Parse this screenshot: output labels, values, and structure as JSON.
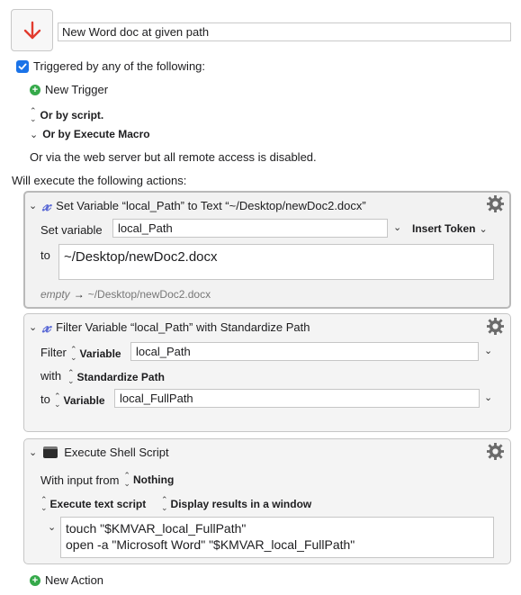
{
  "macro": {
    "name": "New Word doc at given path"
  },
  "triggers": {
    "triggered_label": "Triggered by any of the following:",
    "new_trigger": "New Trigger",
    "or_by_script": "Or by script.",
    "or_by_execute_macro": "Or by Execute Macro",
    "web_server_note": "Or via the web server but all remote access is disabled."
  },
  "actions_header": "Will execute the following actions:",
  "actions": [
    {
      "title": "Set Variable “local_Path” to Text “~/Desktop/newDoc2.docx”",
      "set_variable_label": "Set variable",
      "variable": "local_Path",
      "insert_token": "Insert Token",
      "to_label": "to",
      "text": "~/Desktop/newDoc2.docx",
      "preview_empty": "empty",
      "preview_arrow": "→",
      "preview_value": "~/Desktop/newDoc2.docx"
    },
    {
      "title": "Filter Variable “local_Path” with Standardize Path",
      "filter_label": "Filter",
      "filter_type": "Variable",
      "filter_value": "local_Path",
      "with_label": "with",
      "with_value": "Standardize Path",
      "to_label": "to",
      "to_type": "Variable",
      "to_value": "local_FullPath"
    },
    {
      "title": "Execute Shell Script",
      "input_label": "With input from",
      "input_value": "Nothing",
      "execute_option": "Execute text script",
      "display_option": "Display results in a window",
      "script_line1": "touch \"$KMVAR_local_FullPath\"",
      "script_line2": "open -a \"Microsoft Word\" \"$KMVAR_local_FullPath\""
    }
  ],
  "new_action": "New Action",
  "colors": {
    "accent": "#1a73e8",
    "arrow_red": "#e23b2e",
    "plus_green": "#35a94a",
    "variable_x": "#5c6bd6"
  }
}
